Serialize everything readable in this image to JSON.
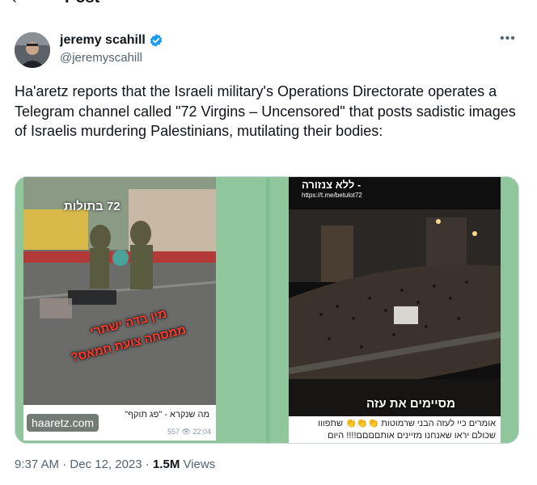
{
  "header": {
    "back_glyph": "‹",
    "title": "Post"
  },
  "author": {
    "display_name": "jeremy scahill",
    "handle": "@jeremyscahill",
    "verified": true,
    "more_glyph": "•••"
  },
  "tweet": {
    "text": "Ha'aretz reports that the Israeli military's Operations Directorate operates a Telegram channel called \"72 Virgins – Uncensored\" that posts sadistic images of Israelis murdering Palestinians, mutilating their bodies:"
  },
  "media": {
    "left": {
      "overlay_hebrew_top": "72 בתולות",
      "overlay_red_line1": "מין בדה ישתרי",
      "overlay_red_line2": "ממסחה צועת חמאס?",
      "caption": "מה שנקרא - \"פג תוקף\"",
      "stats": "557 👁 22:04",
      "watermark": "haaretz.com"
    },
    "right": {
      "overlay_hebrew_top": "- ללא צנזורה",
      "link": "https://t.me/betulot72",
      "overlay_hebrew_mid": "מסיימים את עזה",
      "caption_line1": "אומרים כיי לעזה הבני שרמוטות 👏👏👏 שתפווו",
      "caption_line2": "שכולם יראו שאנחנו מזיינים אותםםםם!!!! היום"
    }
  },
  "meta": {
    "time": "9:37 AM",
    "separator1": " · ",
    "date": "Dec 12, 2023",
    "separator2": " · ",
    "views_count": "1.5M",
    "views_label": " Views"
  },
  "colors": {
    "verified_blue": "#1d9bf0",
    "secondary_text": "#536471",
    "border": "#cfd9de"
  }
}
